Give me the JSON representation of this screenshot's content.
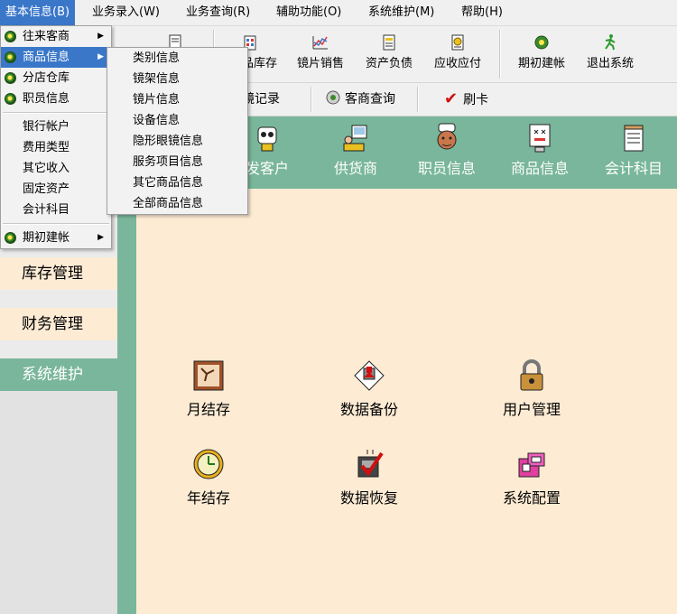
{
  "menubar": [
    "基本信息(B)",
    "业务录入(W)",
    "业务查询(R)",
    "辅助功能(O)",
    "系统维护(M)",
    "帮助(H)"
  ],
  "toolbar": {
    "partial_first_label": "品库存",
    "items": [
      {
        "label": "镜片销售",
        "icon": "chart-icon"
      },
      {
        "label": "资产负债",
        "icon": "ledger-icon"
      },
      {
        "label": "应收应付",
        "icon": "money-icon"
      },
      {
        "label": "期初建帐",
        "icon": "green-disc-icon"
      },
      {
        "label": "退出系统",
        "icon": "running-man-icon"
      }
    ]
  },
  "toolbar2": {
    "partial_label": "镜记录",
    "customer_query": "客商查询",
    "swipe_card": "刷卡"
  },
  "header_icons": [
    "发客户",
    "供货商",
    "职员信息",
    "商品信息",
    "会计科目"
  ],
  "sidebar": {
    "sections": [
      "库存管理",
      "财务管理",
      "系统维护"
    ],
    "active": "系统维护"
  },
  "main_grid": [
    {
      "label": "月结存",
      "icon": "calendar-icon"
    },
    {
      "label": "数据备份",
      "icon": "backup-disk-icon"
    },
    {
      "label": "用户管理",
      "icon": "padlock-icon"
    },
    {
      "label": "年结存",
      "icon": "clock-icon"
    },
    {
      "label": "数据恢复",
      "icon": "restore-check-icon"
    },
    {
      "label": "系统配置",
      "icon": "config-box-icon"
    }
  ],
  "dropdown": {
    "items": [
      "往来客商",
      "商品信息",
      "分店仓库",
      "职员信息"
    ],
    "plain_items": [
      "银行帐户",
      "费用类型",
      "其它收入",
      "固定资产",
      "会计科目"
    ],
    "bottom_item": "期初建帐",
    "highlighted": "商品信息"
  },
  "submenu": {
    "items": [
      "类别信息",
      "镜架信息",
      "镜片信息",
      "设备信息",
      "隐形眼镜信息",
      "服务项目信息",
      "其它商品信息",
      "全部商品信息"
    ]
  },
  "colors": {
    "accent_green": "#79b69b",
    "panel_bg": "#fdebd4",
    "menu_highlight": "#3a77c9"
  }
}
